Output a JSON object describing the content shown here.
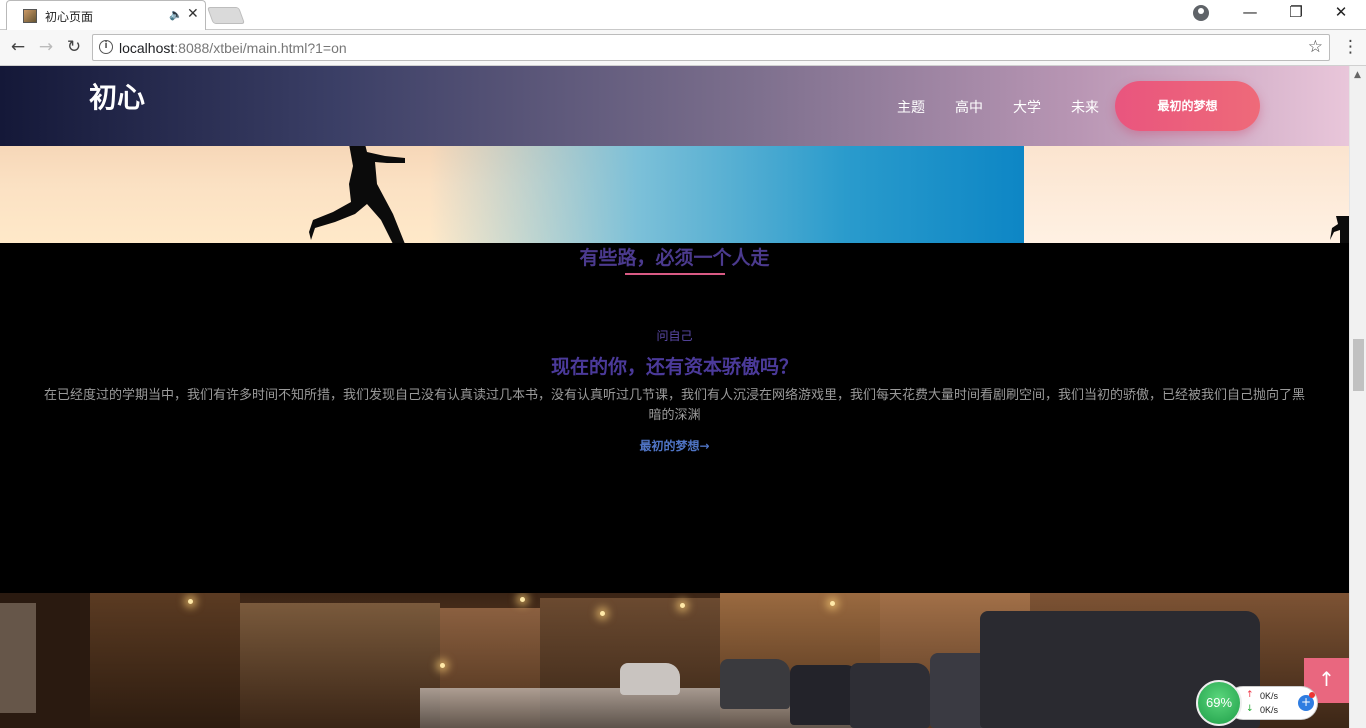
{
  "browser": {
    "tab_title": "初心页面",
    "tab_audio_icon": "🔈",
    "tab_close": "✕",
    "back": "←",
    "forward": "→",
    "reload": "↻",
    "url_host": "localhost",
    "url_rest": ":8088/xtbei/main.html?1=on",
    "star": "☆",
    "menu": "⋮",
    "minimize": "—",
    "restore": "❐",
    "close": "✕"
  },
  "header": {
    "logo": "初心",
    "nav": [
      "主题",
      "高中",
      "大学",
      "未来"
    ],
    "cta": "最初的梦想"
  },
  "section": {
    "heading": "有些路，必须一个人走",
    "eyebrow": "问自己",
    "title": "现在的你，还有资本骄傲吗？",
    "body": "在已经度过的学期当中，我们有许多时间不知所措，我们发现自己没有认真读过几本书，没有认真听过几节课，我们有人沉浸在网络游戏里，我们每天花费大量时间看剧刷空间，我们当初的骄傲，已经被我们自己抛向了黑暗的深渊",
    "link": "最初的梦想→"
  },
  "back_to_top": "↑",
  "net_widget": {
    "percent": "69%",
    "up_arrow": "↑",
    "down_arrow": "↓",
    "up_speed": "0K/s",
    "down_speed": "0K/s",
    "plus": "+"
  },
  "colors": {
    "accent": "#e9557e",
    "heading": "#4b3a8e",
    "link": "#4f74c4"
  }
}
